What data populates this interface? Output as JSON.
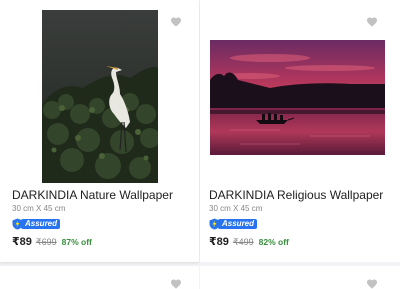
{
  "products": [
    {
      "title": "DARKINDIA Nature Wallpaper",
      "size": "30 cm X 45 cm",
      "assured_label": "Assured",
      "price": "₹89",
      "mrp": "₹699",
      "discount": "87% off"
    },
    {
      "title": "DARKINDIA Religious Wallpaper",
      "size": "30 cm X 45 cm",
      "assured_label": "Assured",
      "price": "₹89",
      "mrp": "₹499",
      "discount": "82% off"
    }
  ],
  "colors": {
    "assured_blue": "#2874f0",
    "assured_yellow": "#ffe500",
    "discount_green": "#388e3c",
    "wishlist_gray": "#c2c2c2"
  },
  "icons": [
    "heart-icon",
    "assured-shield-icon"
  ]
}
